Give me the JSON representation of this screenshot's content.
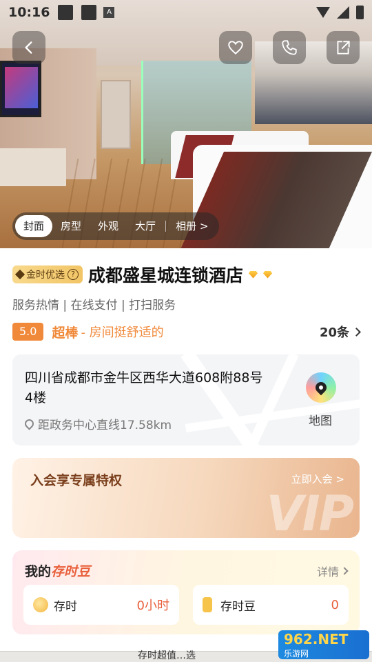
{
  "status_bar": {
    "time": "10:16",
    "indicator": "A"
  },
  "hero": {
    "tabs": [
      {
        "label": "封面",
        "active": true
      },
      {
        "label": "房型",
        "active": false
      },
      {
        "label": "外观",
        "active": false
      },
      {
        "label": "大厅",
        "active": false
      },
      {
        "label": "相册 >",
        "active": false
      }
    ]
  },
  "hotel": {
    "badge": "金时优选",
    "badge_help": "?",
    "name": "成都盛星城连锁酒店",
    "tags": "服务热情 | 在线支付 | 打扫服务",
    "score": "5.0",
    "grade": "超棒",
    "comment": "- 房间挺舒适的",
    "review_count": "20条"
  },
  "address": {
    "text": "四川省成都市金牛区西华大道608附88号4楼",
    "distance": "距政务中心直线17.58km",
    "map_label": "地图"
  },
  "vip": {
    "title": "入会享专属特权",
    "join": "立即入会 >",
    "watermark": "VIP"
  },
  "beans": {
    "title_prefix": "我的",
    "title_highlight": "存时豆",
    "detail": "详情",
    "items": [
      {
        "label": "存时",
        "value": "0小时",
        "icon": "clock-coin-icon"
      },
      {
        "label": "存时豆",
        "value": "0",
        "icon": "bean-phone-icon"
      }
    ]
  },
  "footer": {
    "hint": "存时超值…选"
  },
  "site_watermark": {
    "line1": "962.NET",
    "line2": "乐游网"
  },
  "colors": {
    "accent": "#f08a3a",
    "highlight": "#e8603c",
    "gold": "#f2c566"
  }
}
